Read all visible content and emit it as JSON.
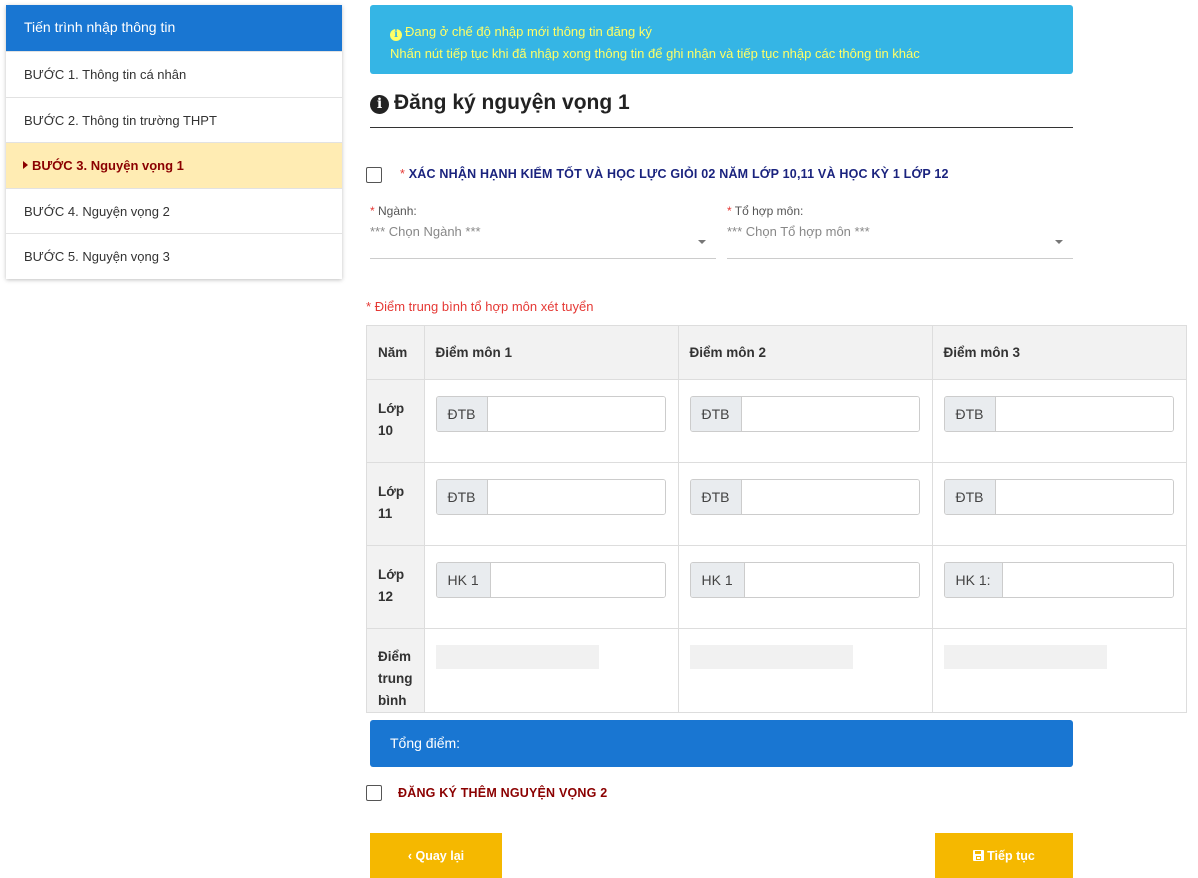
{
  "sidebar": {
    "title": "Tiến trình nhập thông tin",
    "steps": [
      {
        "label": "BƯỚC 1. Thông tin cá nhân"
      },
      {
        "label": "BƯỚC 2. Thông tin trường THPT"
      },
      {
        "label": "BƯỚC 3. Nguyện vọng 1"
      },
      {
        "label": "BƯỚC 4. Nguyện vọng 2"
      },
      {
        "label": "BƯỚC 5. Nguyện vọng 3"
      }
    ],
    "active_step": 3
  },
  "banner": {
    "line1": "Đang ở chế độ nhập mới thông tin đăng ký",
    "line2": "Nhấn nút tiếp tục khi đã nhập xong thông tin để ghi nhận và tiếp tục nhập các thông tin khác",
    "icon": "info-circle-icon"
  },
  "page": {
    "title": "Đăng ký nguyện vọng 1"
  },
  "confirm": {
    "required_mark": "*",
    "label": "XÁC NHẬN HẠNH KIỂM TỐT VÀ HỌC LỰC GIỎI 02 NĂM LỚP 10,11 VÀ HỌC KỲ 1 LỚP 12",
    "checked": false
  },
  "fields": {
    "major": {
      "required_mark": "*",
      "label": "Ngành:",
      "value": "*** Chọn Ngành ***"
    },
    "subject_group": {
      "required_mark": "*",
      "label": "Tổ hợp môn:",
      "value": "*** Chọn Tổ hợp môn ***"
    }
  },
  "scores": {
    "note_mark": "*",
    "note": "Điểm trung bình tổ hợp môn xét tuyển",
    "headers": [
      "Năm",
      "Điểm môn 1",
      "Điểm môn 2",
      "Điểm môn 3"
    ],
    "rows": [
      {
        "label": "Lớp 10",
        "addons": [
          "ĐTB",
          "ĐTB",
          "ĐTB"
        ]
      },
      {
        "label": "Lớp 11",
        "addons": [
          "ĐTB",
          "ĐTB",
          "ĐTB"
        ]
      },
      {
        "label": "Lớp 12",
        "addons": [
          "HK 1",
          "HK 1",
          "HK 1:"
        ]
      }
    ],
    "average_label": "Điểm trung bình"
  },
  "total": {
    "label": "Tổng điểm:"
  },
  "extra": {
    "label": "ĐĂNG KÝ THÊM NGUYỆN VỌNG 2",
    "checked": false
  },
  "buttons": {
    "back": "‹ Quay lại",
    "next": "Tiếp tục"
  },
  "colors": {
    "primary": "#1976d2",
    "banner": "#35b5e5",
    "banner_text": "#ffff66",
    "active_step_bg": "#ffecb3",
    "active_step_text": "#8b0000",
    "button": "#f5b800"
  }
}
